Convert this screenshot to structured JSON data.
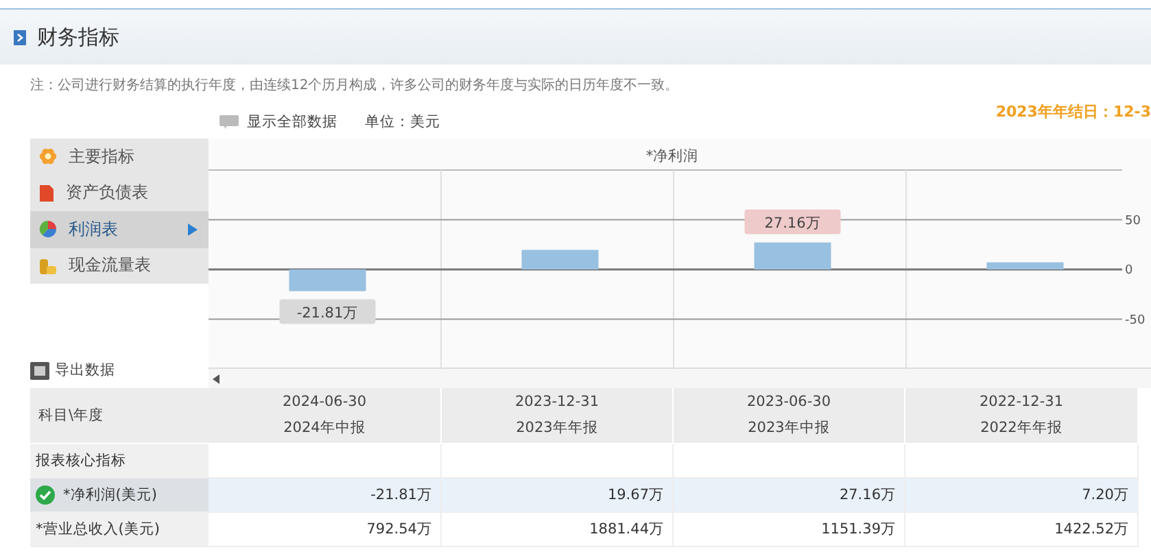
{
  "header": {
    "title": "财务指标"
  },
  "note": "注：公司进行财务结算的执行年度，由连续12个历月构成，许多公司的财务年度与实际的日历年度不一致。",
  "toolbar": {
    "show_all": "显示全部数据",
    "unit": "单位：美元",
    "year_end": "2023年年结日：12-3"
  },
  "sidebar": {
    "items": [
      {
        "label": "主要指标",
        "selected": false
      },
      {
        "label": "资产负债表",
        "selected": false
      },
      {
        "label": "利润表",
        "selected": true
      },
      {
        "label": "现金流量表",
        "selected": false
      }
    ],
    "export": "导出数据"
  },
  "chart": {
    "chart_data": {
      "type": "bar",
      "title": "*净利润",
      "values": [
        -21.81,
        19.67,
        27.16,
        7.2
      ],
      "ylim": [
        -100,
        100
      ],
      "yticks": [
        50,
        0,
        -50
      ],
      "value_labels": [
        "-21.81万",
        null,
        "27.16万",
        null
      ]
    }
  },
  "table": {
    "corner": "科目\\年度",
    "columns": [
      {
        "date": "2024-06-30",
        "report": "2024年中报"
      },
      {
        "date": "2023-12-31",
        "report": "2023年年报"
      },
      {
        "date": "2023-06-30",
        "report": "2023年中报"
      },
      {
        "date": "2022-12-31",
        "report": "2022年年报"
      }
    ],
    "rows": [
      {
        "kind": "section",
        "label": "报表核心指标",
        "selected": false,
        "cells": []
      },
      {
        "kind": "data",
        "label": "*净利润(美元)",
        "selected": true,
        "checked": true,
        "cells": [
          "-21.81万",
          "19.67万",
          "27.16万",
          "7.20万"
        ]
      },
      {
        "kind": "data",
        "label": "*营业总收入(美元)",
        "selected": false,
        "checked": false,
        "cells": [
          "792.54万",
          "1881.44万",
          "1151.39万",
          "1422.52万"
        ]
      }
    ]
  }
}
